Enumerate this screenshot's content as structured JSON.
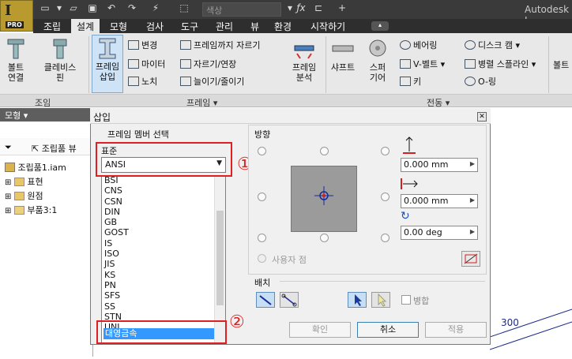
{
  "app": {
    "logo_letter": "I",
    "logo_badge": "PRO",
    "color_box": "색상",
    "title": "Autodesk I"
  },
  "tabs": [
    "조립",
    "설계",
    "모형",
    "검사",
    "도구",
    "관리",
    "뷰",
    "환경",
    "시작하기"
  ],
  "active_tab": "설계",
  "ribbon": {
    "bolt": "볼트\n연결",
    "clevis": "클레비스\n핀",
    "frame_insert": "프레임\n삽입",
    "change": "변경",
    "miter": "마이터",
    "notch": "노치",
    "trim_to_frame": "프레임까지 자르기",
    "trim_extend": "자르기/연장",
    "lengthen": "늘이기/줄이기",
    "frame_analysis": "프레임\n분석",
    "shaft": "샤프트",
    "spur_gear": "스퍼\n기어",
    "bearing": "베어링",
    "v_belt": "V-벨트",
    "key": "키",
    "disc_cam": "디스크 캠",
    "parallel_spline": "병렬 스플라인",
    "o_ring": "O-링",
    "bolt_right": "볼트",
    "groups": [
      "조임",
      "프레임",
      "전동"
    ]
  },
  "browser": {
    "header": "모형",
    "tool": "조립품 뷰",
    "root": "조립품1.iam",
    "items": [
      "표현",
      "원점",
      "부품3:1"
    ]
  },
  "dialog": {
    "title": "삽입",
    "section_member": "프레임 멤버 선택",
    "standard_label": "표준",
    "standard_value": "ANSI",
    "standards": [
      "BSI",
      "CNS",
      "CSN",
      "DIN",
      "GB",
      "GOST",
      "IS",
      "ISO",
      "JIS",
      "KS",
      "PN",
      "SFS",
      "SS",
      "STN",
      "UNI",
      "대영금속"
    ],
    "selected_standard": "대영금속",
    "orientation_label": "방향",
    "offset_x": "0.000 mm",
    "offset_y": "0.000 mm",
    "rotation": "0.00 deg",
    "custom_point": "사용자 점",
    "placement_label": "배치",
    "merge_label": "병합",
    "ok": "확인",
    "cancel": "취소",
    "apply": "적용"
  },
  "annotations": {
    "one": "①",
    "two": "②"
  },
  "canvas": {
    "dimension": "300"
  },
  "colors": {
    "accent_red": "#e02020",
    "selection_blue": "#3399ff",
    "logo_gold": "#b89a2e"
  }
}
